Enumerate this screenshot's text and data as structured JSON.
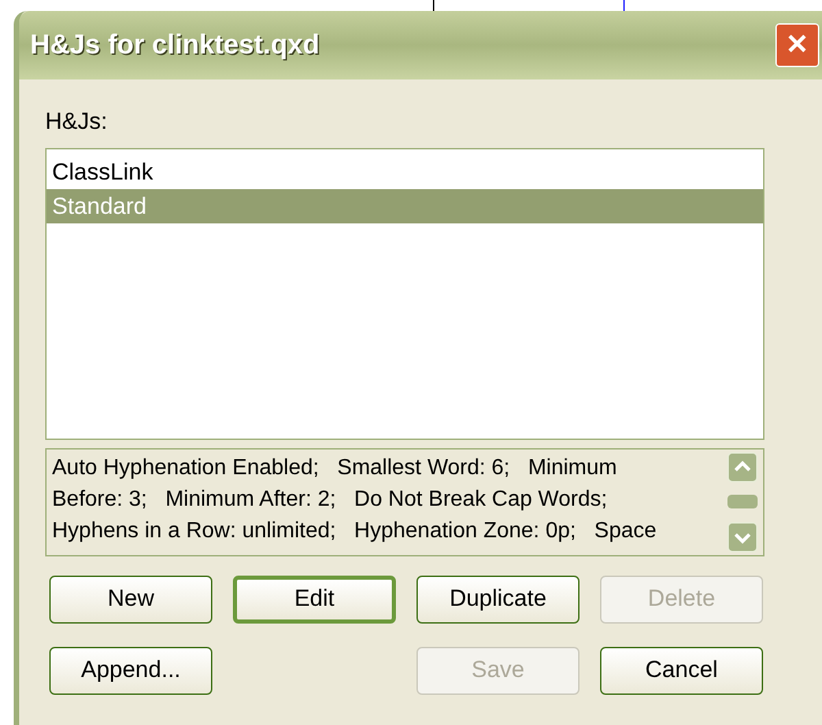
{
  "window": {
    "title": "H&Js for clinktest.qxd",
    "close_icon": "✕"
  },
  "list": {
    "label": "H&Js:",
    "items": [
      {
        "label": "ClassLink",
        "selected": false
      },
      {
        "label": "Standard",
        "selected": true
      }
    ]
  },
  "description": {
    "lines": [
      "Auto Hyphenation Enabled;   Smallest Word: 6;   Minimum",
      "Before: 3;   Minimum After: 2;   Do Not Break Cap Words;",
      "Hyphens in a Row: unlimited;   Hyphenation Zone: 0p;   Space"
    ]
  },
  "button_rows": [
    [
      {
        "label": "New",
        "disabled": false,
        "default": false
      },
      {
        "label": "Edit",
        "disabled": false,
        "default": true
      },
      {
        "label": "Duplicate",
        "disabled": false,
        "default": false
      },
      {
        "label": "Delete",
        "disabled": true,
        "default": false
      }
    ],
    {
      "left": [
        {
          "label": "Append...",
          "disabled": false,
          "default": false
        }
      ],
      "right": [
        {
          "label": "Save",
          "disabled": true,
          "default": false
        },
        {
          "label": "Cancel",
          "disabled": false,
          "default": false
        }
      ]
    }
  ]
}
